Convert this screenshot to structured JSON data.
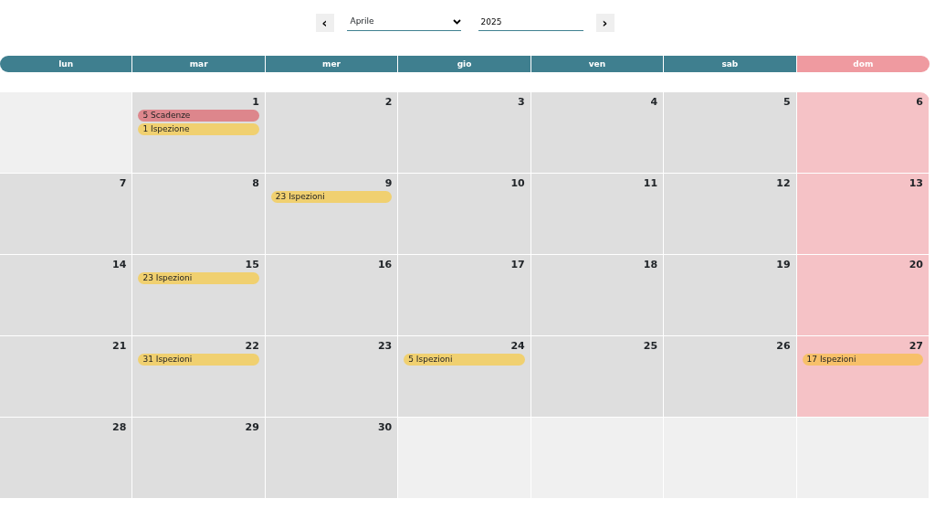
{
  "navigation": {
    "prev": "‹",
    "month": "Aprile",
    "year": "2025",
    "next": "›"
  },
  "weekdays": [
    {
      "label": "lun",
      "holiday": false
    },
    {
      "label": "mar",
      "holiday": false
    },
    {
      "label": "mer",
      "holiday": false
    },
    {
      "label": "gio",
      "holiday": false
    },
    {
      "label": "ven",
      "holiday": false
    },
    {
      "label": "sab",
      "holiday": false
    },
    {
      "label": "dom",
      "holiday": true
    }
  ],
  "weeks": [
    [
      {
        "kind": "blank"
      },
      {
        "day": "1",
        "events": [
          {
            "label": "5 Scadenze",
            "color": "#dd868c"
          },
          {
            "label": "1 Ispezione",
            "color": "#f0d070"
          }
        ]
      },
      {
        "day": "2"
      },
      {
        "day": "3"
      },
      {
        "day": "4"
      },
      {
        "day": "5"
      },
      {
        "day": "6"
      }
    ],
    [
      {
        "day": "7"
      },
      {
        "day": "8"
      },
      {
        "day": "9",
        "events": [
          {
            "label": "23 Ispezioni",
            "color": "#f0d070"
          }
        ]
      },
      {
        "day": "10"
      },
      {
        "day": "11"
      },
      {
        "day": "12"
      },
      {
        "day": "13"
      }
    ],
    [
      {
        "day": "14"
      },
      {
        "day": "15",
        "events": [
          {
            "label": "23 Ispezioni",
            "color": "#f0d070"
          }
        ]
      },
      {
        "day": "16"
      },
      {
        "day": "17"
      },
      {
        "day": "18"
      },
      {
        "day": "19"
      },
      {
        "day": "20"
      }
    ],
    [
      {
        "day": "21"
      },
      {
        "day": "22",
        "events": [
          {
            "label": "31 Ispezioni",
            "color": "#f0d070"
          }
        ]
      },
      {
        "day": "23"
      },
      {
        "day": "24",
        "events": [
          {
            "label": "5 Ispezioni",
            "color": "#f0d070"
          }
        ]
      },
      {
        "day": "25"
      },
      {
        "day": "26"
      },
      {
        "day": "27",
        "events": [
          {
            "label": "17 Ispezioni",
            "color": "#f7c06a"
          }
        ]
      }
    ],
    [
      {
        "day": "28"
      },
      {
        "day": "29"
      },
      {
        "day": "30"
      },
      {
        "kind": "blank"
      },
      {
        "kind": "blank"
      },
      {
        "kind": "blank"
      },
      {
        "kind": "blank"
      }
    ]
  ]
}
